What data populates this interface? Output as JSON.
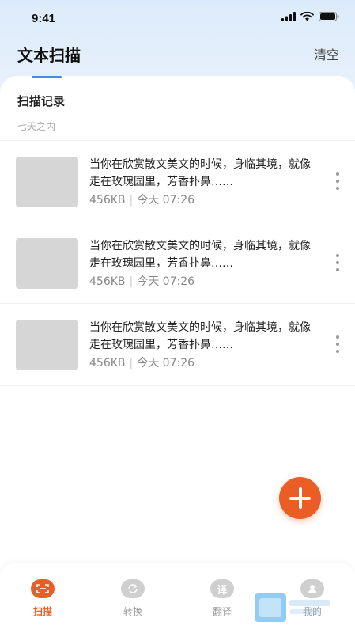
{
  "status_bar": {
    "time": "9:41"
  },
  "header": {
    "title": "文本扫描",
    "clear_label": "清空"
  },
  "section": {
    "title": "扫描记录",
    "subtitle": "七天之内"
  },
  "records": [
    {
      "text": "当你在欣赏散文美文的时候，身临其境，就像走在玫瑰园里，芳香扑鼻……",
      "size": "456KB",
      "time": "今天 07:26"
    },
    {
      "text": "当你在欣赏散文美文的时候，身临其境，就像走在玫瑰园里，芳香扑鼻……",
      "size": "456KB",
      "time": "今天 07:26"
    },
    {
      "text": "当你在欣赏散文美文的时候，身临其境，就像走在玫瑰园里，芳香扑鼻……",
      "size": "456KB",
      "time": "今天 07:26"
    }
  ],
  "tabs": [
    {
      "label": "扫描",
      "icon": "scan-icon"
    },
    {
      "label": "转换",
      "icon": "convert-icon"
    },
    {
      "label": "翻译",
      "icon": "translate-icon",
      "glyph": "译"
    },
    {
      "label": "我的",
      "icon": "profile-icon"
    }
  ],
  "colors": {
    "accent": "#ea5d24",
    "tab_indicator": "#3d8ef0",
    "thumbnail": "#d6d6d6"
  }
}
